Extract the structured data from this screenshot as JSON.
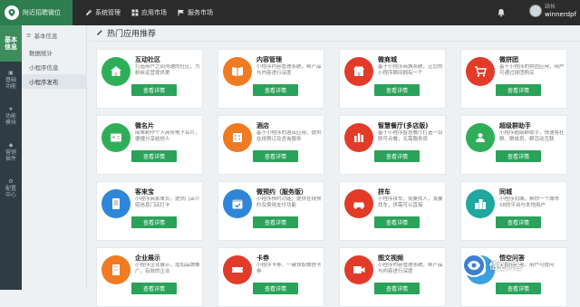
{
  "app": {
    "logo_text": "附近招聘微位"
  },
  "topnav": [
    {
      "label": "系统管理",
      "icon": "wrench-icon"
    },
    {
      "label": "应用市场",
      "icon": "grid-icon"
    },
    {
      "label": "服务市场",
      "icon": "flag-icon"
    }
  ],
  "user": {
    "role": "站长",
    "name": "winnerdpf"
  },
  "side1": [
    {
      "label": "基本信息",
      "active": true
    },
    {
      "label": "基础功能"
    },
    {
      "label": "功能模块"
    },
    {
      "label": "营销插件"
    },
    {
      "label": "配置中心"
    }
  ],
  "side2": {
    "header": "基本信息",
    "items": [
      "数据统计",
      "小程序信息",
      "小程序发布"
    ]
  },
  "main": {
    "title": "热门应用推荐",
    "detail_label": "查看详情",
    "apps": [
      {
        "name": "互动社区",
        "desc": "打造用户之间沟通的社区，为粉丝运营提供更",
        "color": "#2fae59",
        "icon": "home-icon"
      },
      {
        "name": "内容管理",
        "desc": "小程序内容管理系统，帮产品与内容进行深度",
        "color": "#f07b22",
        "icon": "book-icon"
      },
      {
        "name": "微商城",
        "desc": "基于小程序商城系统，让您的小程序瞬间拥有一个",
        "color": "#e23b2a",
        "icon": "store-icon"
      },
      {
        "name": "微拼团",
        "desc": "基于小程序的拼团应用，用户可通过拼团购买",
        "color": "#e23b2a",
        "icon": "cart-icon"
      },
      {
        "name": "微名片",
        "desc": "简单制作个人商务电子名片，便捷分享给他人",
        "color": "#2fae59",
        "icon": "card-icon"
      },
      {
        "name": "酒店",
        "desc": "基于小程序的酒店应用，提供在线预订及咨询服务",
        "color": "#f07b22",
        "icon": "hotel-icon"
      },
      {
        "name": "智慧餐厅(多店版)",
        "desc": "基于小程序智慧餐厅打造一目即可点餐，无需服务员",
        "color": "#e23b2a",
        "icon": "chef-icon"
      },
      {
        "name": "超级群助手",
        "desc": "小程序超级群助手，快速将社群、群成员、群活动互联",
        "color": "#2fae59",
        "icon": "group-icon"
      },
      {
        "name": "客来宝",
        "desc": "小程序商家单页，提供门店介绍信息门店打卡",
        "color": "#2f86d8",
        "icon": "shop-icon"
      },
      {
        "name": "微预约（服务版）",
        "desc": "小程序预约功能，提供在线预约及费用支付功能",
        "color": "#2f86d8",
        "icon": "calendar-icon"
      },
      {
        "name": "拼车",
        "desc": "小程序拼车，我要找人，我要找车，供需可以直接",
        "color": "#e23b2a",
        "icon": "car-icon"
      },
      {
        "name": "同城",
        "desc": "小程序同城，帮你一个城市58的平台与本地用户",
        "color": "#1fa7a0",
        "icon": "city-icon"
      },
      {
        "name": "企业展示",
        "desc": "小程序企业展示，增加品牌推广，有效的企业",
        "color": "#f07b22",
        "icon": "building-icon"
      },
      {
        "name": "卡券",
        "desc": "小程序卡券，一键领取微信卡券",
        "color": "#e23b2a",
        "icon": "ticket-icon"
      },
      {
        "name": "图文视频",
        "desc": "小程序内容管理系统，帮产品与内容进行深度",
        "color": "#e23b2a",
        "icon": "video-icon"
      },
      {
        "name": "悟空问答",
        "desc": "小程序问答，用户可提问",
        "color": "#3ba1e0",
        "icon": "question-icon"
      }
    ]
  },
  "watermark": {
    "text": "悟空问答"
  }
}
